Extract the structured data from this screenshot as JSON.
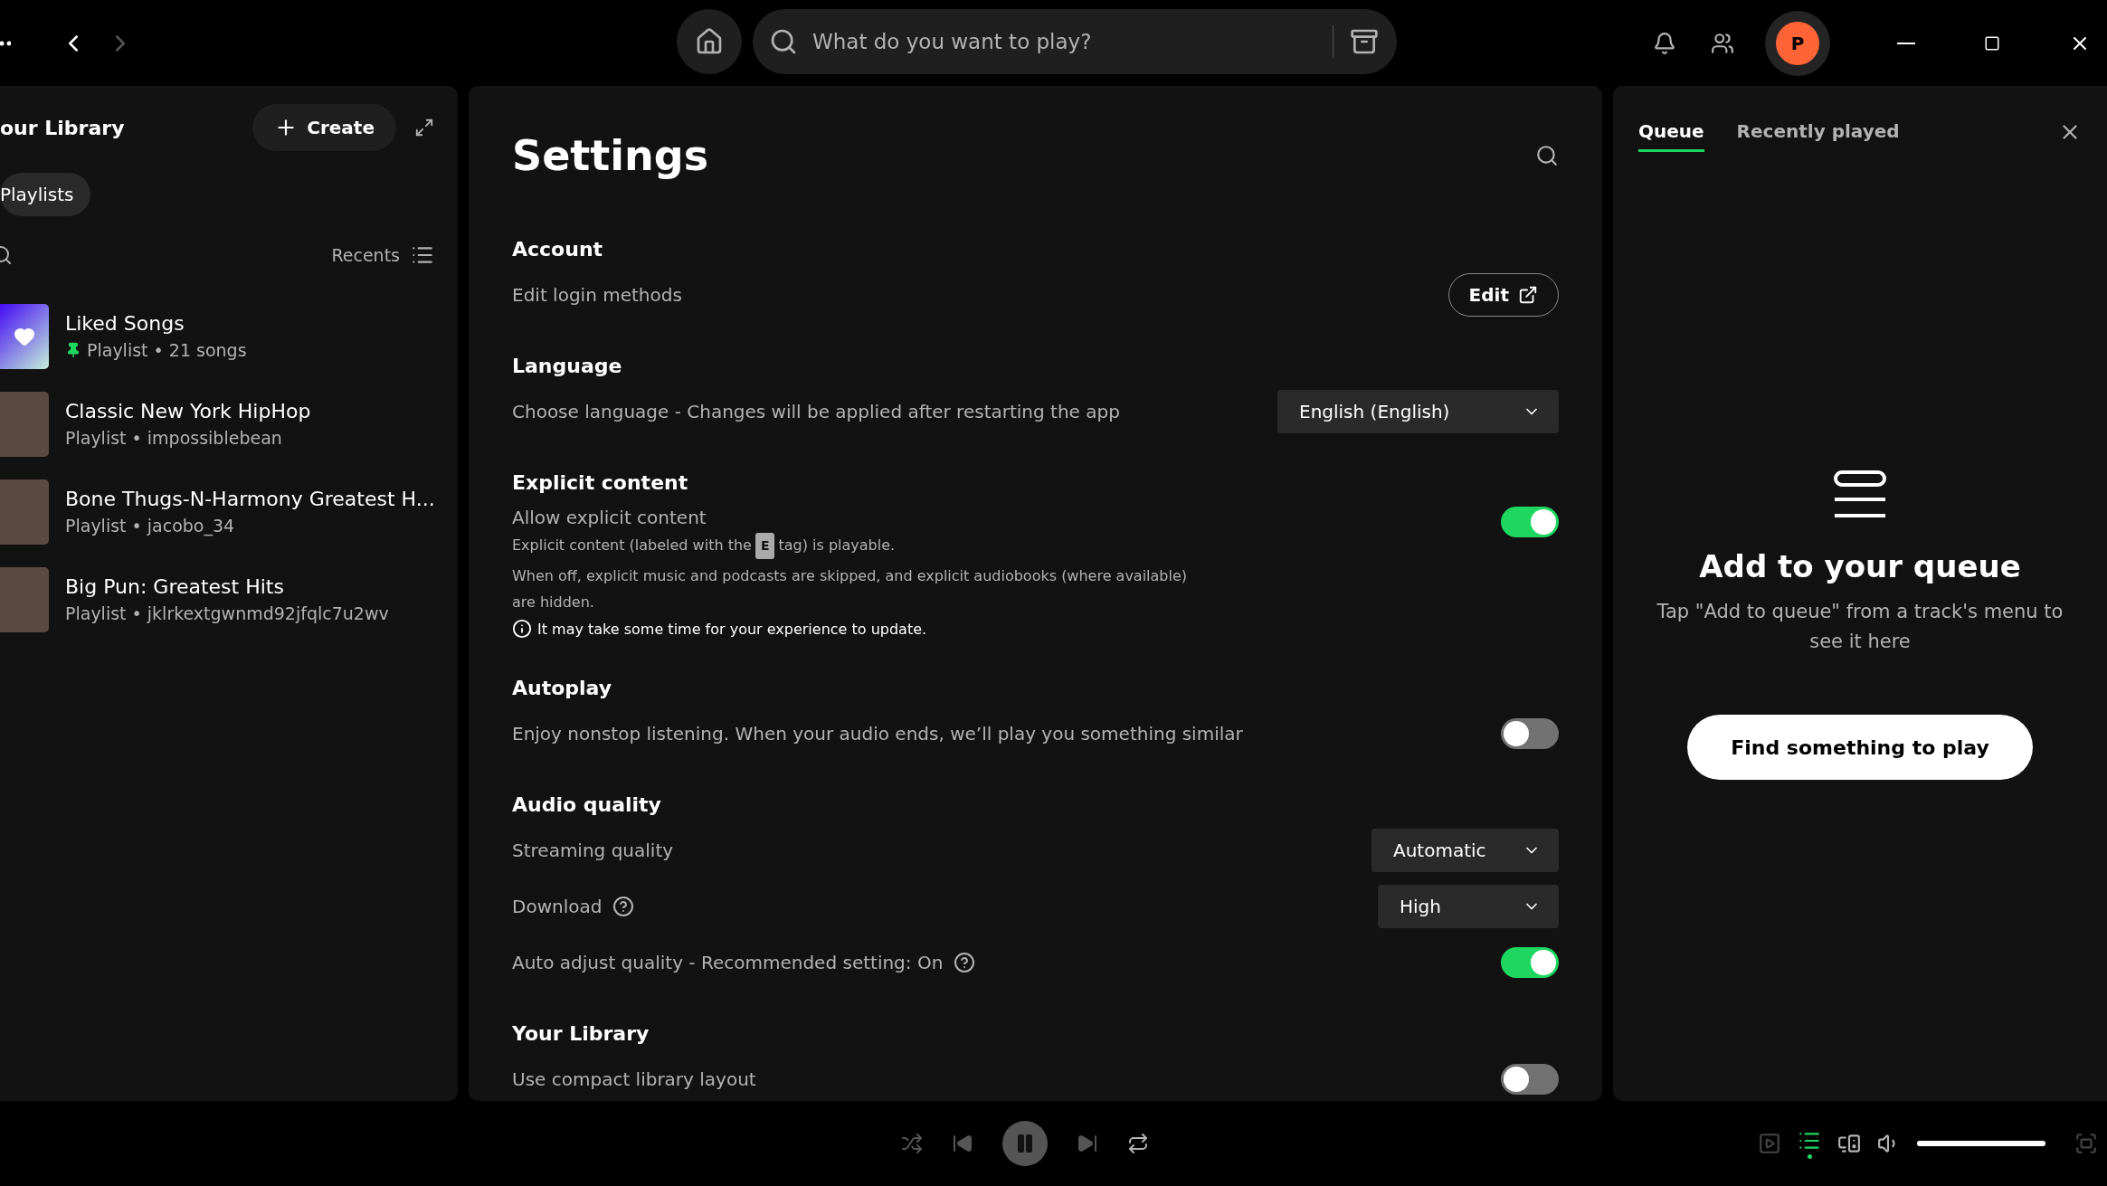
{
  "top_bar": {
    "search": {
      "placeholder": "What do you want to play?"
    },
    "avatar": {
      "initial": "P"
    }
  },
  "library": {
    "title": "our Library",
    "create": "Create",
    "filters": [
      {
        "label": "Playlists",
        "selected": false
      }
    ],
    "sort": "Recents",
    "items": [
      {
        "kind": "liked",
        "title": "Liked Songs",
        "subtitle": "Playlist • 21 songs",
        "pinned": true
      },
      {
        "kind": "cover",
        "title": "Classic New York HipHop",
        "subtitle": "Playlist • impossiblebean",
        "pinned": false
      },
      {
        "kind": "cover",
        "title": "Bone Thugs-N-Harmony Greatest H...",
        "subtitle": "Playlist • jacobo_34",
        "pinned": false
      },
      {
        "kind": "cover",
        "title": "Big Pun: Greatest Hits",
        "subtitle": "Playlist • jklrkextgwnmd92jfqlc7u2wv",
        "pinned": false
      }
    ]
  },
  "settings": {
    "title": "Settings",
    "sections": [
      {
        "heading": "Account",
        "rows": [
          {
            "kind": "button",
            "label": "Edit login methods",
            "button": "Edit"
          }
        ]
      },
      {
        "heading": "Language",
        "rows": [
          {
            "kind": "select",
            "label": "Choose language - Changes will be applied after restarting the app",
            "value": "English (English)"
          }
        ]
      },
      {
        "heading": "Explicit content",
        "rows": [
          {
            "kind": "toggle",
            "label": "Allow explicit content",
            "on": true,
            "detail": {
              "before": "Explicit content (labeled with the",
              "tag": "E",
              "after": "tag) is playable.",
              "note": "When off, explicit music and podcasts are skipped, and explicit audiobooks (where available) are hidden.",
              "info": "It may take some time for your experience to update."
            }
          }
        ]
      },
      {
        "heading": "Autoplay",
        "rows": [
          {
            "kind": "toggle",
            "label": "Enjoy nonstop listening. When your audio ends, we’ll play you something similar",
            "on": false
          }
        ]
      },
      {
        "heading": "Audio quality",
        "rows": [
          {
            "kind": "select",
            "label": "Streaming quality",
            "value": "Automatic"
          },
          {
            "kind": "select",
            "label": "Download",
            "value": "High",
            "help": true
          },
          {
            "kind": "toggle",
            "label": "Auto adjust quality - Recommended setting: On",
            "on": true,
            "help": true
          }
        ]
      },
      {
        "heading": "Your Library",
        "rows": [
          {
            "kind": "toggle",
            "label": "Use compact library layout",
            "on": false
          }
        ]
      }
    ]
  },
  "queue": {
    "tabs": [
      {
        "label": "Queue",
        "selected": true
      },
      {
        "label": "Recently played",
        "selected": false
      }
    ],
    "empty_title": "Add to your queue",
    "empty_text": "Tap \"Add to queue\" from a track's menu to see it here",
    "button": "Find something to play"
  },
  "player": {
    "playing": true,
    "queue_open": true,
    "volume": {
      "level": 1
    }
  }
}
